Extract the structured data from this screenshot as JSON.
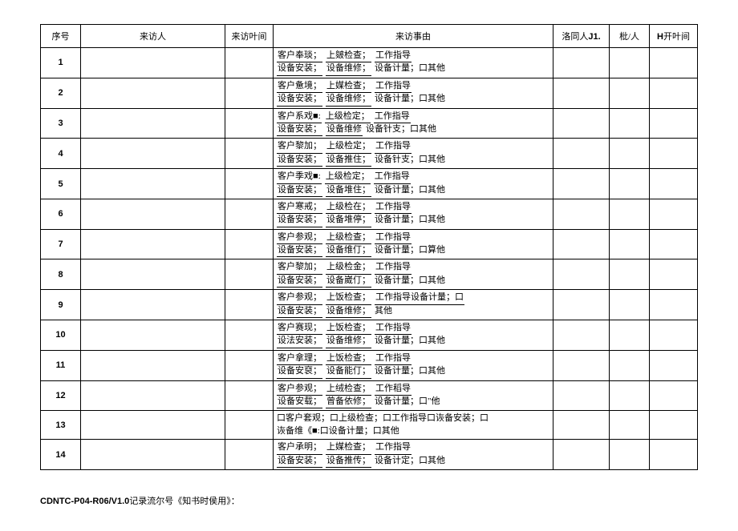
{
  "headers": {
    "seq": "序号",
    "visitor": "来访人",
    "time": "来访叶间",
    "reason": "来访事由",
    "accomp_pre": "洛同人",
    "accomp_suf": "J1.",
    "approve": "枇/人",
    "leave_pre": "H",
    "leave_suf": "开叶间"
  },
  "rows": [
    {
      "seq": "1",
      "l1a": "客户奉琰；",
      "l1b": "上皴检查；",
      "l1c": "工作指导",
      "l2a": "设备安装；",
      "l2b": "设备维修；",
      "l2c": "设备计量；口其他"
    },
    {
      "seq": "2",
      "l1a": "客户惫境；",
      "l1b": "上媒检查；",
      "l1c": "工作指导",
      "l2a": "设备安装；",
      "l2b": "设备维修；",
      "l2c": "设备计量；口其他"
    },
    {
      "seq": "3",
      "l1a": "客户系戏■:",
      "l1b": "上级检定；",
      "l1c": "工作指导",
      "l2a": "设备安装；",
      "l2b": "设备维修",
      "l2c": "设备针支；口其他"
    },
    {
      "seq": "4",
      "l1a": "客户黎加；",
      "l1b": "上级检定；",
      "l1c": "工作指导",
      "l2a": "设备安装；",
      "l2b": "设备推住；",
      "l2c": "设备针支；口其他"
    },
    {
      "seq": "5",
      "l1a": "客户季戏■:",
      "l1b": "上级检定；",
      "l1c": "工作指导",
      "l2a": "设备安装；",
      "l2b": "设备堆住；",
      "l2c": "设备计量；口其他"
    },
    {
      "seq": "6",
      "l1a": "客户寒戒；",
      "l1b": "上级检在；",
      "l1c": "工作指导",
      "l2a": "设备安装；",
      "l2b": "设备堆停；",
      "l2c": "设备计量；口其他"
    },
    {
      "seq": "7",
      "l1a": "客户参观；",
      "l1b": "上级检查；",
      "l1c": "工作指导",
      "l2a": "设备安装；",
      "l2b": "设备维仃；",
      "l2c": "设备计量；口算他"
    },
    {
      "seq": "8",
      "l1a": "客户黎加；",
      "l1b": "上级检金；",
      "l1c": "工作指导",
      "l2a": "设备安装；",
      "l2b": "设备崴仃；",
      "l2c": "设备计量；口其他"
    },
    {
      "seq": "9",
      "l1a": "客户参观；",
      "l1b": "上饭检查；",
      "l1c": "工作指导设备计量；口",
      "l2a": "设备安装；",
      "l2b": "设备维修；",
      "l2c": "其他"
    },
    {
      "seq": "10",
      "l1a": "客户赛现；",
      "l1b": "上饭检查；",
      "l1c": "工作指导",
      "l2a": "设法安装；",
      "l2b": "设备维修；",
      "l2c": "设备计量；口其他"
    },
    {
      "seq": "11",
      "l1a": "客户拿理；",
      "l1b": "上饭检查；",
      "l1c": "工作指导",
      "l2a": "设备安裒；",
      "l2b": "设备能仃；",
      "l2c": "设备计量；口其他"
    },
    {
      "seq": "12",
      "l1a": "客户参观；",
      "l1b": "上绒检查；",
      "l1c": "工作稻导",
      "l2a": "设备安载；",
      "l2b": "曾备依修；",
      "l2c": "设备计量；口\"他"
    },
    {
      "seq": "13",
      "special": "口客户套观；口上级检查；口工作指导口诙备安装；口\n诙备维《■:口设备计量；口其他"
    },
    {
      "seq": "14",
      "l1a": "客户承明；",
      "l1b": "上媒检查；",
      "l1c": "工作指导",
      "l2a": "设备安装；",
      "l2b": "设备推传；",
      "l2c": "设备计定；口其他"
    }
  ],
  "footer": {
    "code": "CDNTC-P04-R06/V1.0",
    "text": "记录流尔号《知书时侯用》："
  }
}
